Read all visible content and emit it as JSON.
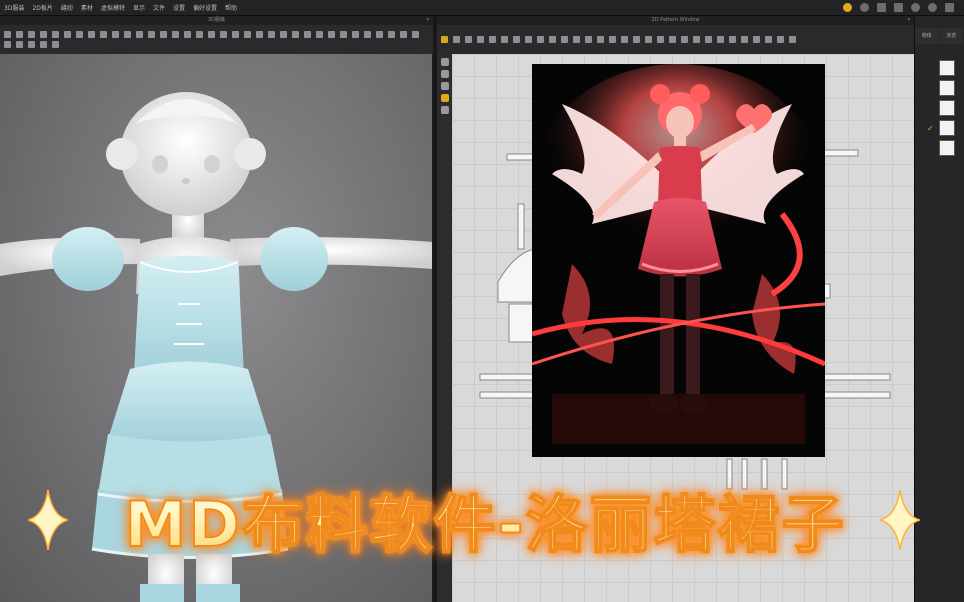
{
  "menubar": {
    "items": [
      "3D服装",
      "2D板片",
      "缝纫",
      "素材",
      "虚拟模特",
      "显示",
      "文件",
      "设置",
      "偏好设置",
      "帮助"
    ]
  },
  "panes": {
    "left_title": "3D服装",
    "right_title": "2D Pattern Window"
  },
  "rightpanel": {
    "tab1": "物体",
    "tab2": "浏览"
  },
  "overlay": {
    "title": "MD布料软件-洛丽塔裙子"
  },
  "colors": {
    "accent": "#e7a81e",
    "title_stroke": "#f08a1c",
    "dress": "#bfe3ea",
    "viewport_bg": "#717173",
    "pattern_bg": "#d9d9d9"
  }
}
